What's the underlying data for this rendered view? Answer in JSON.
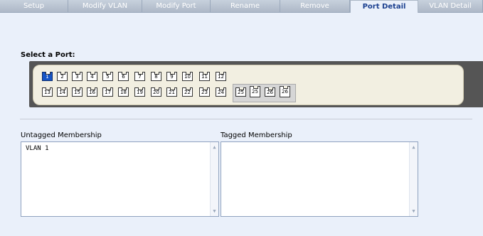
{
  "tabs": [
    {
      "label": "Setup",
      "active": false
    },
    {
      "label": "Modify VLAN",
      "active": false
    },
    {
      "label": "Modify Port",
      "active": false
    },
    {
      "label": "Rename",
      "active": false
    },
    {
      "label": "Remove",
      "active": false
    },
    {
      "label": "Port Detail",
      "active": true
    },
    {
      "label": "VLAN Detail",
      "active": false
    }
  ],
  "select_port_label": "Select a Port:",
  "ports_row1": [
    "1",
    "2",
    "3",
    "4",
    "5",
    "6",
    "7",
    "8",
    "9",
    "10",
    "11",
    "12"
  ],
  "ports_row2": [
    "13",
    "14",
    "15",
    "16",
    "17",
    "18",
    "19",
    "20",
    "21",
    "22",
    "23",
    "24"
  ],
  "sfp_ports": [
    "25",
    "25",
    "26",
    "26"
  ],
  "selected_port": "1",
  "untagged": {
    "label": "Untagged Membership",
    "value": "VLAN 1"
  },
  "tagged": {
    "label": "Tagged Membership",
    "value": ""
  },
  "colors": {
    "accent": "#1755c6",
    "tab_text_active": "#1a3f8f",
    "background": "#eaf0fa"
  }
}
